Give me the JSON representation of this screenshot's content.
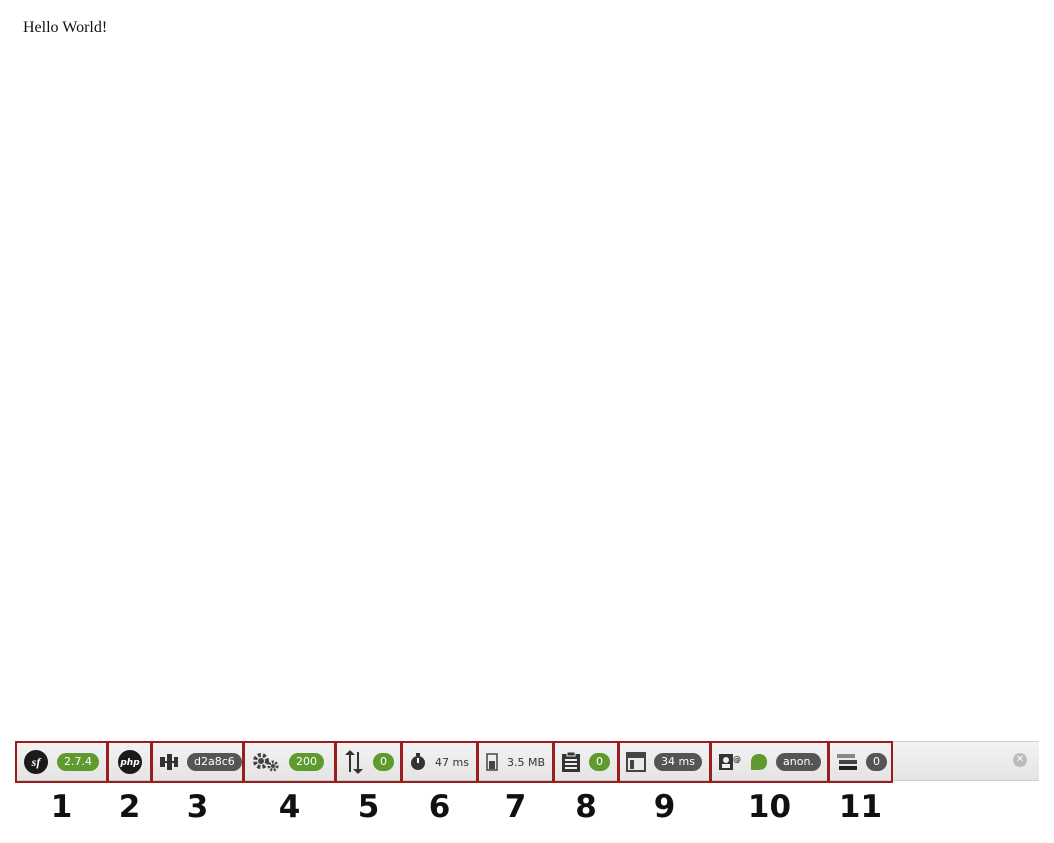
{
  "page": {
    "body_text": "Hello World!"
  },
  "toolbar": {
    "items": [
      {
        "icon": "symfony-logo-icon",
        "value": "2.7.4"
      },
      {
        "icon": "php-logo-icon",
        "value": ""
      },
      {
        "icon": "route-controller-icon",
        "value": "d2a8c6"
      },
      {
        "icon": "gears-icon",
        "value": "200"
      },
      {
        "icon": "ajax-arrows-icon",
        "value": "0"
      },
      {
        "icon": "timer-icon",
        "value": "47 ms"
      },
      {
        "icon": "memory-icon",
        "value": "3.5 MB"
      },
      {
        "icon": "clipboard-log-icon",
        "value": "0"
      },
      {
        "icon": "twig-template-icon",
        "value": "34 ms"
      },
      {
        "icon": "user-card-icon",
        "value": "anon."
      },
      {
        "icon": "database-stack-icon",
        "value": "0"
      }
    ],
    "close_icon": "close-icon"
  },
  "annotations": [
    "1",
    "2",
    "3",
    "4",
    "5",
    "6",
    "7",
    "8",
    "9",
    "10",
    "11"
  ],
  "colors": {
    "badge_green": "#5f9a2f",
    "badge_gray": "#555555",
    "annotation_border": "#9b1c1c",
    "toolbar_bg": "#eaeaea"
  }
}
